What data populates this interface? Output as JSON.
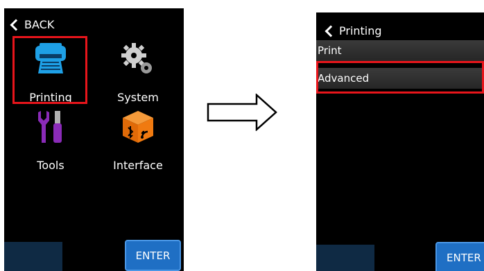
{
  "left_screen": {
    "back_label": "BACK",
    "tiles": [
      {
        "label": "Printing",
        "icon": "printer-icon",
        "color": "#1ea0e6"
      },
      {
        "label": "System",
        "icon": "gears-icon",
        "color": "#cfcfcf"
      },
      {
        "label": "Tools",
        "icon": "tools-icon",
        "color": "#8a2bb8"
      },
      {
        "label": "Interface",
        "icon": "interface-cube-icon",
        "color": "#f07a10"
      }
    ],
    "enter_label": "ENTER"
  },
  "right_screen": {
    "title": "Printing",
    "items": [
      {
        "label": "Print"
      },
      {
        "label": "Advanced"
      }
    ],
    "enter_label": "ENTER"
  },
  "highlight_color": "#e8151b",
  "arrow_icon": "right-arrow-icon"
}
